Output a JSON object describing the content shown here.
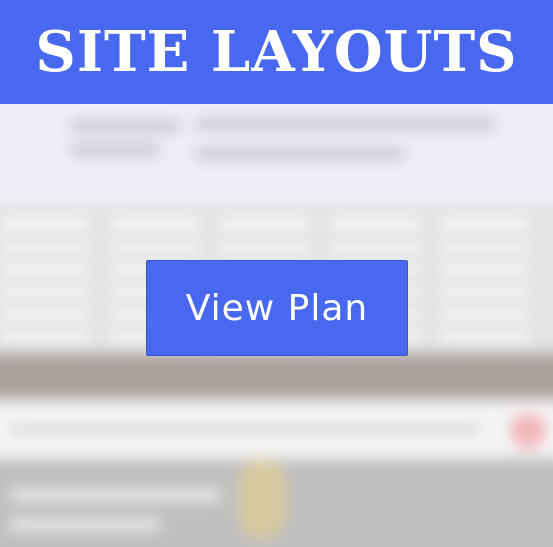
{
  "header": {
    "title": "SITE LAYOUTS",
    "background": "#4868f0"
  },
  "cta": {
    "label": "View Plan",
    "background": "#4868f0"
  },
  "colors": {
    "brand_blue": "#4868f0",
    "text_white": "#ffffff"
  }
}
